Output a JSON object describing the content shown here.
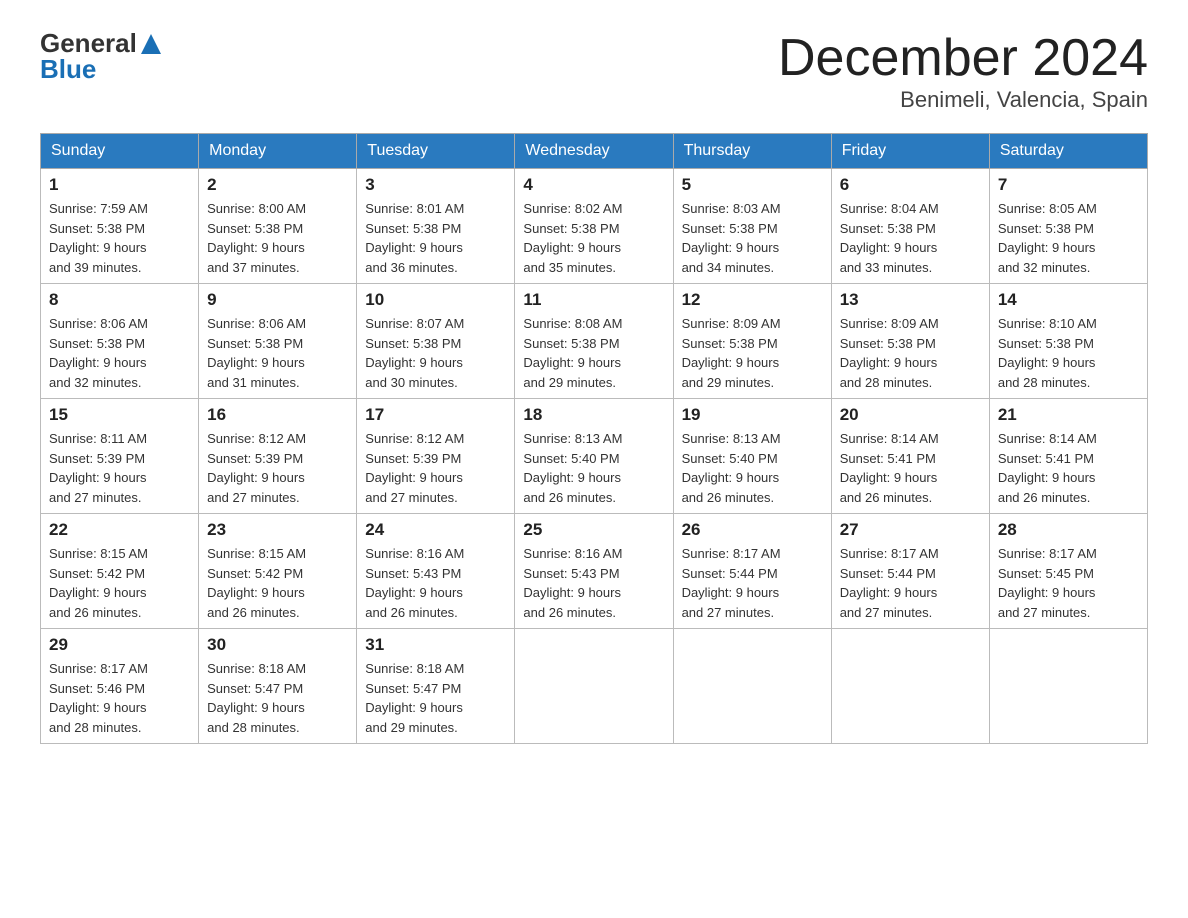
{
  "logo": {
    "text_general": "General",
    "text_blue": "Blue",
    "arrow": "▲"
  },
  "title": {
    "month_year": "December 2024",
    "location": "Benimeli, Valencia, Spain"
  },
  "weekdays": [
    "Sunday",
    "Monday",
    "Tuesday",
    "Wednesday",
    "Thursday",
    "Friday",
    "Saturday"
  ],
  "weeks": [
    [
      {
        "day": "1",
        "sunrise": "7:59 AM",
        "sunset": "5:38 PM",
        "daylight": "9 hours and 39 minutes."
      },
      {
        "day": "2",
        "sunrise": "8:00 AM",
        "sunset": "5:38 PM",
        "daylight": "9 hours and 37 minutes."
      },
      {
        "day": "3",
        "sunrise": "8:01 AM",
        "sunset": "5:38 PM",
        "daylight": "9 hours and 36 minutes."
      },
      {
        "day": "4",
        "sunrise": "8:02 AM",
        "sunset": "5:38 PM",
        "daylight": "9 hours and 35 minutes."
      },
      {
        "day": "5",
        "sunrise": "8:03 AM",
        "sunset": "5:38 PM",
        "daylight": "9 hours and 34 minutes."
      },
      {
        "day": "6",
        "sunrise": "8:04 AM",
        "sunset": "5:38 PM",
        "daylight": "9 hours and 33 minutes."
      },
      {
        "day": "7",
        "sunrise": "8:05 AM",
        "sunset": "5:38 PM",
        "daylight": "9 hours and 32 minutes."
      }
    ],
    [
      {
        "day": "8",
        "sunrise": "8:06 AM",
        "sunset": "5:38 PM",
        "daylight": "9 hours and 32 minutes."
      },
      {
        "day": "9",
        "sunrise": "8:06 AM",
        "sunset": "5:38 PM",
        "daylight": "9 hours and 31 minutes."
      },
      {
        "day": "10",
        "sunrise": "8:07 AM",
        "sunset": "5:38 PM",
        "daylight": "9 hours and 30 minutes."
      },
      {
        "day": "11",
        "sunrise": "8:08 AM",
        "sunset": "5:38 PM",
        "daylight": "9 hours and 29 minutes."
      },
      {
        "day": "12",
        "sunrise": "8:09 AM",
        "sunset": "5:38 PM",
        "daylight": "9 hours and 29 minutes."
      },
      {
        "day": "13",
        "sunrise": "8:09 AM",
        "sunset": "5:38 PM",
        "daylight": "9 hours and 28 minutes."
      },
      {
        "day": "14",
        "sunrise": "8:10 AM",
        "sunset": "5:38 PM",
        "daylight": "9 hours and 28 minutes."
      }
    ],
    [
      {
        "day": "15",
        "sunrise": "8:11 AM",
        "sunset": "5:39 PM",
        "daylight": "9 hours and 27 minutes."
      },
      {
        "day": "16",
        "sunrise": "8:12 AM",
        "sunset": "5:39 PM",
        "daylight": "9 hours and 27 minutes."
      },
      {
        "day": "17",
        "sunrise": "8:12 AM",
        "sunset": "5:39 PM",
        "daylight": "9 hours and 27 minutes."
      },
      {
        "day": "18",
        "sunrise": "8:13 AM",
        "sunset": "5:40 PM",
        "daylight": "9 hours and 26 minutes."
      },
      {
        "day": "19",
        "sunrise": "8:13 AM",
        "sunset": "5:40 PM",
        "daylight": "9 hours and 26 minutes."
      },
      {
        "day": "20",
        "sunrise": "8:14 AM",
        "sunset": "5:41 PM",
        "daylight": "9 hours and 26 minutes."
      },
      {
        "day": "21",
        "sunrise": "8:14 AM",
        "sunset": "5:41 PM",
        "daylight": "9 hours and 26 minutes."
      }
    ],
    [
      {
        "day": "22",
        "sunrise": "8:15 AM",
        "sunset": "5:42 PM",
        "daylight": "9 hours and 26 minutes."
      },
      {
        "day": "23",
        "sunrise": "8:15 AM",
        "sunset": "5:42 PM",
        "daylight": "9 hours and 26 minutes."
      },
      {
        "day": "24",
        "sunrise": "8:16 AM",
        "sunset": "5:43 PM",
        "daylight": "9 hours and 26 minutes."
      },
      {
        "day": "25",
        "sunrise": "8:16 AM",
        "sunset": "5:43 PM",
        "daylight": "9 hours and 26 minutes."
      },
      {
        "day": "26",
        "sunrise": "8:17 AM",
        "sunset": "5:44 PM",
        "daylight": "9 hours and 27 minutes."
      },
      {
        "day": "27",
        "sunrise": "8:17 AM",
        "sunset": "5:44 PM",
        "daylight": "9 hours and 27 minutes."
      },
      {
        "day": "28",
        "sunrise": "8:17 AM",
        "sunset": "5:45 PM",
        "daylight": "9 hours and 27 minutes."
      }
    ],
    [
      {
        "day": "29",
        "sunrise": "8:17 AM",
        "sunset": "5:46 PM",
        "daylight": "9 hours and 28 minutes."
      },
      {
        "day": "30",
        "sunrise": "8:18 AM",
        "sunset": "5:47 PM",
        "daylight": "9 hours and 28 minutes."
      },
      {
        "day": "31",
        "sunrise": "8:18 AM",
        "sunset": "5:47 PM",
        "daylight": "9 hours and 29 minutes."
      },
      null,
      null,
      null,
      null
    ]
  ],
  "labels": {
    "sunrise": "Sunrise:",
    "sunset": "Sunset:",
    "daylight": "Daylight:"
  }
}
